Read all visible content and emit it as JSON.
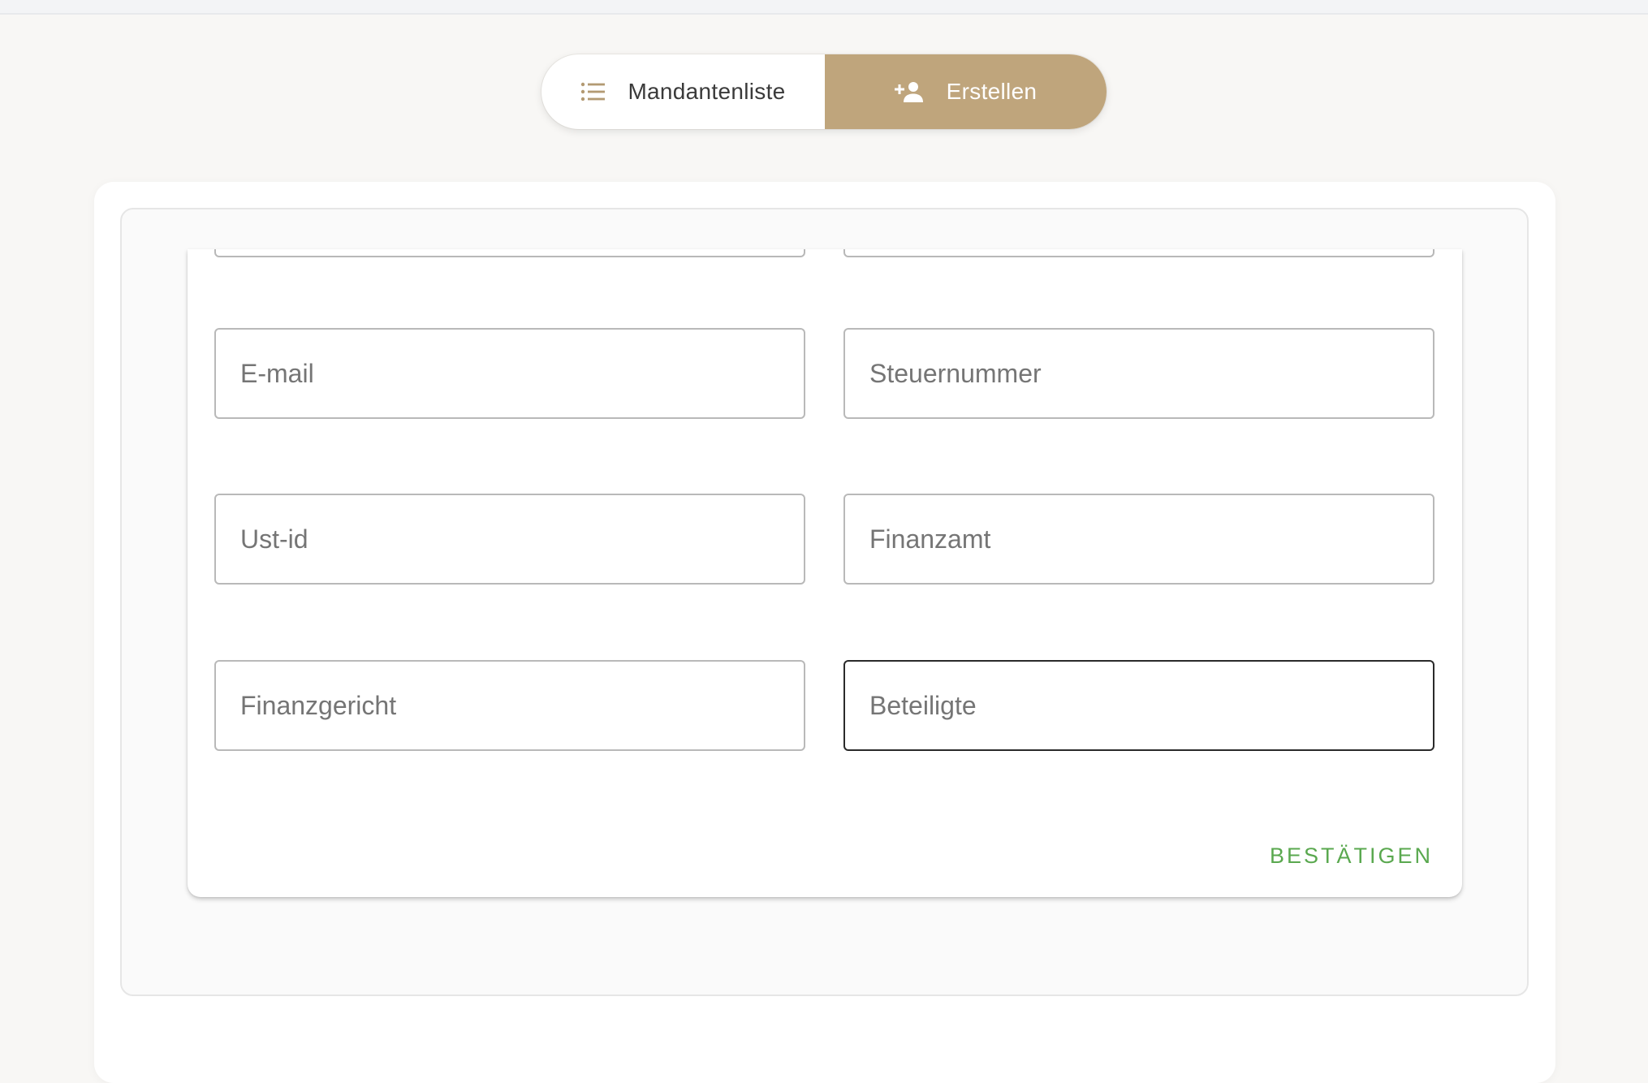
{
  "nav": {
    "list_label": "Mandantenliste",
    "list_icon": "list-icon",
    "create_label": "Erstellen",
    "create_icon": "person-add-icon",
    "active_tab": "create",
    "accent_color": "#bfa57c"
  },
  "form": {
    "fields": {
      "email": {
        "placeholder": "E-mail",
        "value": ""
      },
      "tax_number": {
        "placeholder": "Steuernummer",
        "value": ""
      },
      "vat_id": {
        "placeholder": "Ust-id",
        "value": ""
      },
      "tax_office": {
        "placeholder": "Finanzamt",
        "value": ""
      },
      "tax_court": {
        "placeholder": "Finanzgericht",
        "value": ""
      },
      "parties": {
        "placeholder": "Beteiligte",
        "value": "",
        "focused": true
      }
    },
    "confirm_label": "BESTÄTIGEN",
    "confirm_color": "#5aa84f"
  }
}
